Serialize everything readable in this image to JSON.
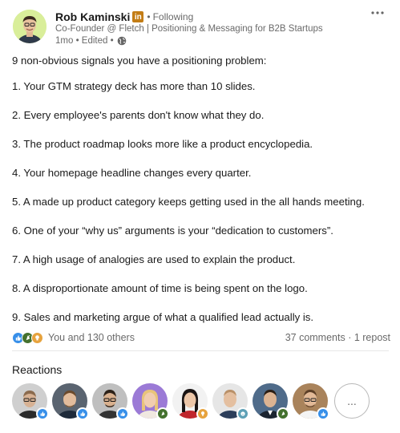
{
  "author": {
    "name": "Rob Kaminski",
    "network_badge": "in",
    "separator": "•",
    "follow_status": "Following",
    "headline": "Co-Founder @ Fletch | Positioning & Messaging for B2B Startups",
    "meta": "1mo • Edited •",
    "visibility_icon": "globe-icon"
  },
  "more_menu_label": "···",
  "post": {
    "lines": [
      "9 non-obvious signals you have a positioning problem:",
      "1. Your GTM strategy deck has more than 10 slides.",
      "2. Every employee's parents don't know what they do.",
      "3. The product roadmap looks more like a product encyclopedia.",
      "4. Your homepage headline changes every quarter.",
      "5. A made up product category keeps getting used in the all hands meeting.",
      "6. One of your “why us” arguments is your “dedication to customers”.",
      "7. A high usage of analogies are used to explain the product.",
      "8. A disproportionate amount of time is being spent on the logo.",
      "9. Sales and marketing argue of what a qualified lead actually is."
    ]
  },
  "social": {
    "reaction_types": [
      "like-icon",
      "celebrate-icon",
      "insightful-icon"
    ],
    "reactors_text": "You and 130 others",
    "counts_text": "37 comments · 1 repost"
  },
  "reactions_section": {
    "heading": "Reactions",
    "reactors": [
      {
        "badge": "like-icon"
      },
      {
        "badge": "like-icon"
      },
      {
        "badge": "like-icon"
      },
      {
        "badge": "celebrate-icon"
      },
      {
        "badge": "insightful-icon"
      },
      {
        "badge": "funny-icon"
      },
      {
        "badge": "celebrate-icon"
      },
      {
        "badge": "like-icon"
      }
    ],
    "more_label": "..."
  },
  "colors": {
    "like": "#378fe9",
    "celebrate": "#44712e",
    "insightful": "#e7a33e",
    "funny": "#5ea0b6",
    "li_badge": "#c37d16"
  }
}
